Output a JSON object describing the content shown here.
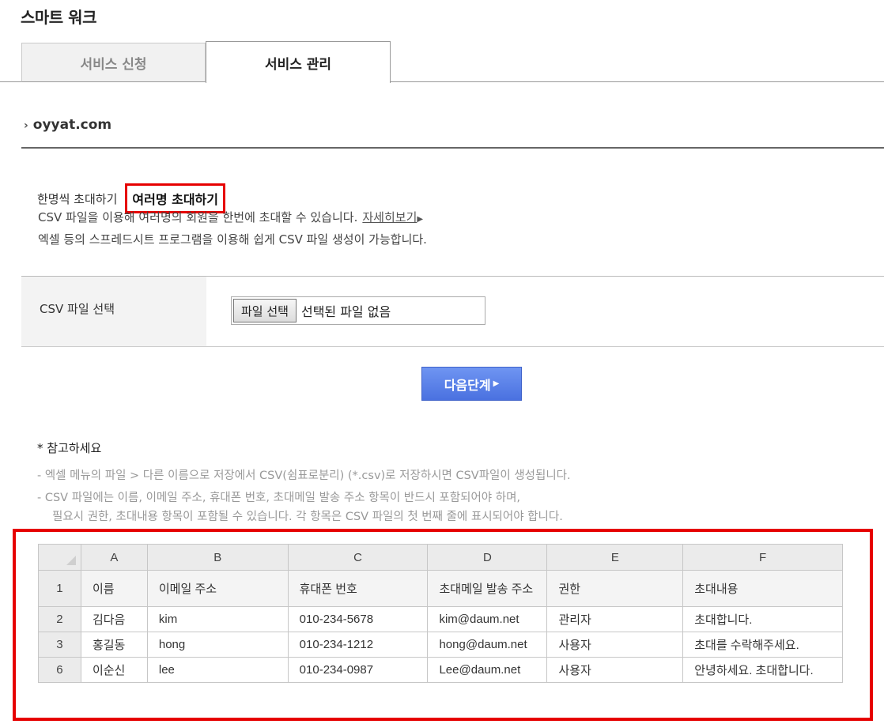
{
  "page_title": "스마트 워크",
  "tabs": [
    {
      "label": "서비스 신청",
      "active": false
    },
    {
      "label": "서비스 관리",
      "active": true
    }
  ],
  "domain": "oyyat.com",
  "invite": {
    "single_label": "한명씩 초대하기",
    "multi_label": "여러명 초대하기",
    "desc1": "CSV 파일을 이용해 여러명의 회원을 한번에 초대할 수 있습니다.",
    "more_link": "자세히보기",
    "desc2": "엑셀 등의 스프레드시트 프로그램을 이용해 쉽게 CSV 파일 생성이 가능합니다."
  },
  "csv": {
    "label": "CSV 파일 선택",
    "file_button": "파일 선택",
    "file_status": "선택된 파일 없음"
  },
  "next_button": "다음단계",
  "note": {
    "title": "* 참고하세요",
    "lines": [
      "- 엑셀 메뉴의 파일 > 다른 이름으로 저장에서 CSV(쉼표로분리) (*.csv)로 저장하시면 CSV파일이 생성됩니다.",
      "- CSV 파일에는 이름, 이메일 주소, 휴대폰 번호, 초대메일 발송 주소 항목이 반드시 포함되어야 하며,",
      "필요시 권한, 초대내용 항목이 포함될 수 있습니다. 각 항목은 CSV 파일의 첫 번째 줄에 표시되어야 합니다."
    ]
  },
  "sheet": {
    "columns": [
      "A",
      "B",
      "C",
      "D",
      "E",
      "F"
    ],
    "header_row": {
      "num": "1",
      "cells": [
        "이름",
        "이메일 주소",
        "휴대폰 번호",
        "초대메일 발송 주소",
        "권한",
        "초대내용"
      ]
    },
    "rows": [
      {
        "num": "2",
        "cells": [
          "김다음",
          "kim",
          "010-234-5678",
          "kim@daum.net",
          "관리자",
          "초대합니다."
        ]
      },
      {
        "num": "3",
        "cells": [
          "홍길동",
          "hong",
          "010-234-1212",
          "hong@daum.net",
          "사용자",
          "초대를 수락해주세요."
        ]
      },
      {
        "num": "6",
        "cells": [
          "이순신",
          "lee",
          "010-234-0987",
          "Lee@daum.net",
          "사용자",
          "안녕하세요. 초대합니다."
        ]
      }
    ]
  }
}
